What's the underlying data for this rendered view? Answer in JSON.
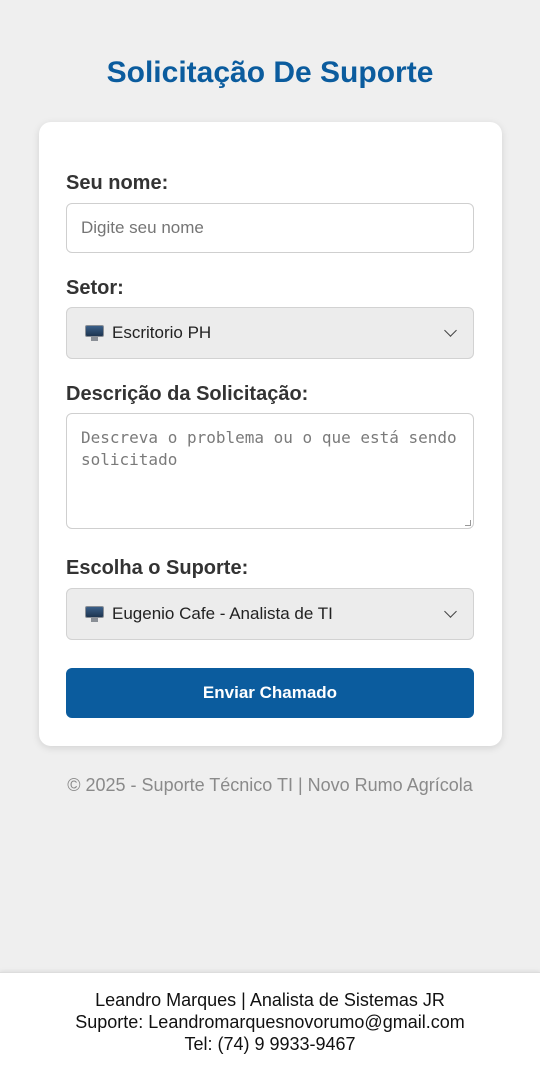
{
  "page": {
    "title": "Solicitação De Suporte"
  },
  "form": {
    "name_label": "Seu nome:",
    "name_placeholder": "Digite seu nome",
    "sector_label": "Setor:",
    "sector_icon": "monitor-icon",
    "sector_value": "Escritorio PH",
    "description_label": "Descrição da Solicitação:",
    "description_placeholder": "Descreva o problema ou o que está sendo solicitado",
    "support_label": "Escolha o Suporte:",
    "support_icon": "monitor-icon",
    "support_value": "Eugenio Cafe - Analista de TI",
    "submit_label": "Enviar Chamado"
  },
  "copyright": "© 2025 - Suporte Técnico TI | Novo Rumo Agrícola",
  "footer": {
    "line1": "Leandro Marques | Analista de Sistemas JR",
    "line2": "Suporte: Leandromarquesnovorumo@gmail.com",
    "line3": "Tel: (74) 9 9933-9467"
  },
  "colors": {
    "accent": "#0b5c9e",
    "background": "#efefef"
  }
}
